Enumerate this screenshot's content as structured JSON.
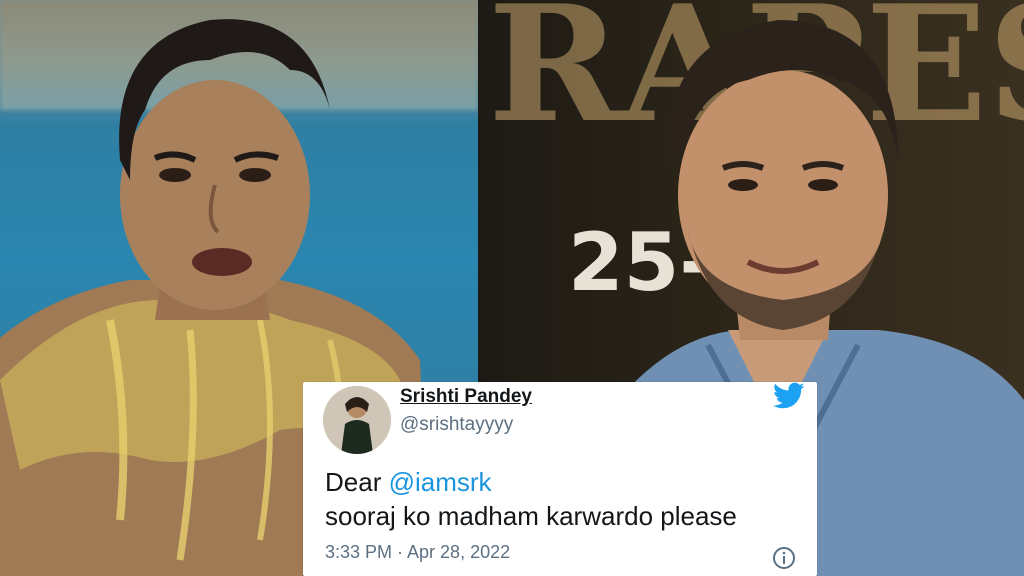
{
  "left_photo": {
    "icon": "person-in-water-photo"
  },
  "right_photo": {
    "icon": "person-at-event-photo",
    "backdrop_text": "25-1",
    "backdrop_letters": "RAPES"
  },
  "tweet": {
    "author_name": "Srishti Pandey",
    "author_handle": "@srishtayyyy",
    "body_prefix": "Dear ",
    "mention": "@iamsrk",
    "body_line2": "sooraj ko madham karwardo please",
    "timestamp": "3:33 PM · Apr 28, 2022",
    "brand_icon": "twitter-bird-icon",
    "info_icon": "info-icon",
    "colors": {
      "mention": "#1b95e0",
      "brand": "#1da1f2",
      "secondary_text": "#5b7083"
    }
  }
}
